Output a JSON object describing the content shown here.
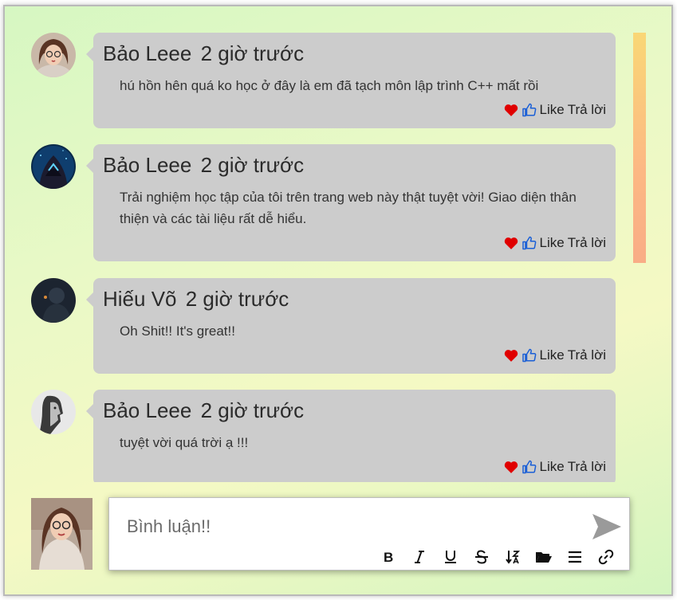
{
  "comments": [
    {
      "author": "Bảo Leee",
      "time": "2 giờ trước",
      "text": "hú hồn hên quá ko học ở đây là em đã tạch môn lập trình C++ mất rồi",
      "like_label": "Like",
      "reply_label": "Trả lời",
      "avatar": "woman-glasses-avatar"
    },
    {
      "author": "Bảo Leee",
      "time": "2 giờ trước",
      "text": "Trải nghiệm học tập của tôi trên trang web này thật tuyệt vời! Giao diện thân thiện và các tài liệu rất dễ hiểu.",
      "like_label": "Like",
      "reply_label": "Trả lời",
      "avatar": "hooded-figure-avatar"
    },
    {
      "author": "Hiếu Võ",
      "time": "2 giờ trước",
      "text": "Oh Shit!! It's great!!",
      "like_label": "Like",
      "reply_label": "Trả lời",
      "avatar": "dark-portrait-avatar"
    },
    {
      "author": "Bảo Leee",
      "time": "2 giờ trước",
      "text": "tuyệt vời quá trời ạ !!!",
      "like_label": "Like",
      "reply_label": "Trả lời",
      "avatar": "man-profile-avatar"
    }
  ],
  "composer": {
    "placeholder": "Bình luận!!",
    "tools": [
      "bold-icon",
      "italic-icon",
      "underline-icon",
      "strikethrough-icon",
      "sort-icon",
      "folder-icon",
      "list-icon",
      "link-icon"
    ]
  },
  "colors": {
    "bubble": "#cccccc",
    "heart": "#e00000",
    "thumb": "#1a5fd6",
    "send": "#9a9a9a",
    "scrollbar_top": "#f9d776",
    "scrollbar_bottom": "#f9ad86"
  }
}
